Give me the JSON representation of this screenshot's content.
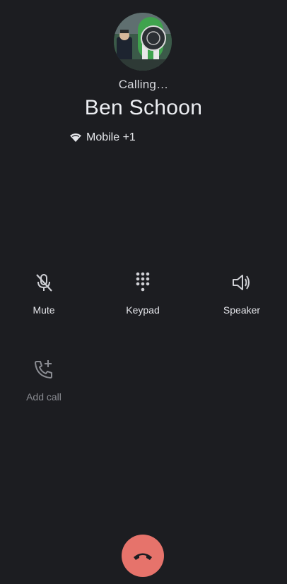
{
  "call": {
    "status": "Calling…",
    "caller_name": "Ben Schoon",
    "network_label": "Mobile +1"
  },
  "icons": {
    "network": "wifi-calling-icon",
    "mute": "mic-off-icon",
    "keypad": "dialpad-icon",
    "speaker": "speaker-icon",
    "add_call": "add-call-icon",
    "end_call": "call-end-icon"
  },
  "controls": {
    "mute_label": "Mute",
    "keypad_label": "Keypad",
    "speaker_label": "Speaker",
    "add_call_label": "Add call"
  },
  "colors": {
    "background": "#1c1d21",
    "end_call": "#e6736b",
    "text_primary": "#eceef2",
    "text_disabled": "#8a8c92"
  }
}
